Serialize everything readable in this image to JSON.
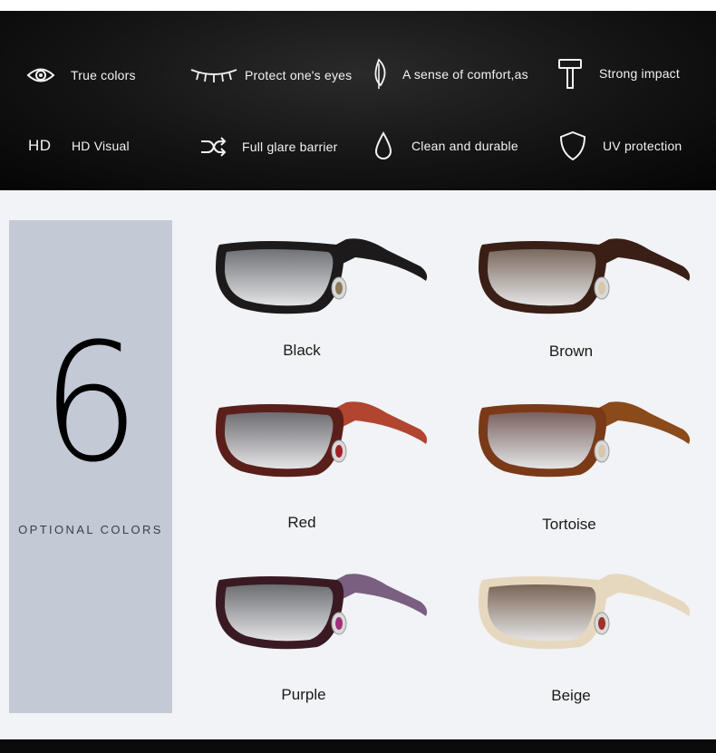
{
  "features": [
    {
      "icon": "eye-icon",
      "label": "True colors"
    },
    {
      "icon": "eyelash-icon",
      "label": "Protect one's eyes"
    },
    {
      "icon": "feather-icon",
      "label": "A sense of comfort,as"
    },
    {
      "icon": "hammer-icon",
      "label": "Strong impact"
    },
    {
      "icon": "hd-icon",
      "label": "HD Visual",
      "icon_text": "HD"
    },
    {
      "icon": "shuffle-icon",
      "label": "Full glare barrier"
    },
    {
      "icon": "water-drop-icon",
      "label": "Clean and durable"
    },
    {
      "icon": "shield-icon",
      "label": "UV protection"
    }
  ],
  "options": {
    "count": "6",
    "label": "OPTIONAL COLORS"
  },
  "colors": [
    {
      "name": "Black",
      "frame": "#1c1a1b",
      "temple": "#1c1a1b",
      "lens": "#6f7276",
      "gem": "#8a7a5a"
    },
    {
      "name": "Brown",
      "frame": "#3a1f17",
      "temple": "#3a1f17",
      "lens": "#7a6a5e",
      "gem": "#d8c7a8"
    },
    {
      "name": "Red",
      "frame": "#5a1f1a",
      "temple": "#b2452f",
      "lens": "#6d6d72",
      "gem": "#a0202a"
    },
    {
      "name": "Tortoise",
      "frame": "#7a3a18",
      "temple": "#8a4a1a",
      "lens": "#7a6260",
      "gem": "#d8c7a8"
    },
    {
      "name": "Purple",
      "frame": "#3a1a22",
      "temple": "#7a5f80",
      "lens": "#6c6e72",
      "gem": "#a0307a"
    },
    {
      "name": "Beige",
      "frame": "#e6d8bf",
      "temple": "#e6d8bf",
      "lens": "#7a6658",
      "gem": "#a0302a"
    }
  ]
}
